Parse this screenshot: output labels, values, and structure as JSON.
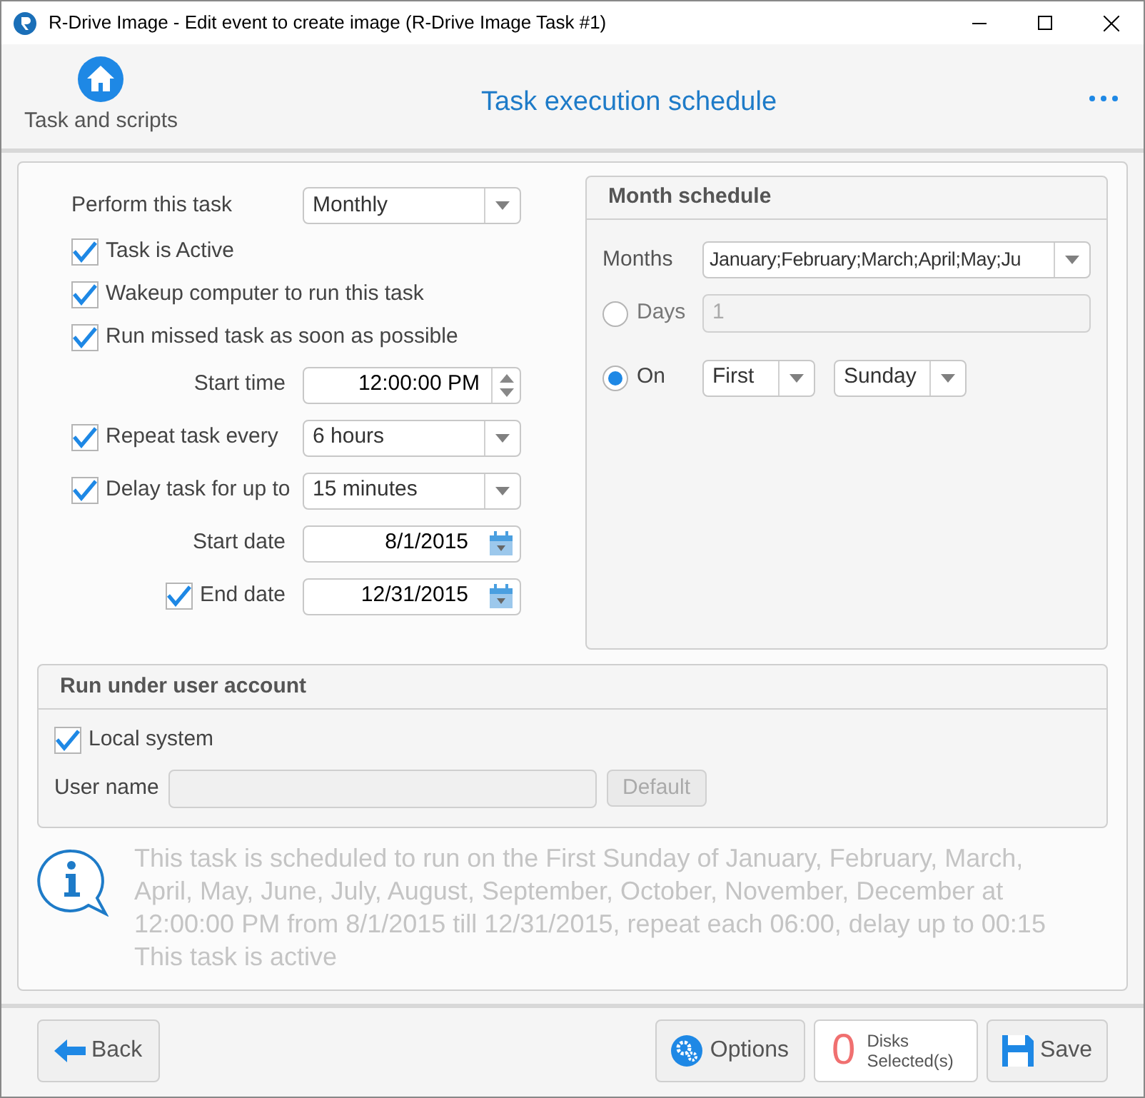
{
  "window": {
    "title": "R-Drive Image - Edit event to create image (R-Drive Image Task #1)"
  },
  "header": {
    "home_label": "Task and scripts",
    "title": "Task execution schedule"
  },
  "left_fields": [
    {
      "kind": "select",
      "label": "Perform this task",
      "value": "Monthly"
    },
    {
      "kind": "checkbox",
      "label": "Task is Active",
      "checked": true
    },
    {
      "kind": "checkbox",
      "label": "Wakeup computer to run this task",
      "checked": true
    },
    {
      "kind": "checkbox",
      "label": "Run missed task as soon as possible",
      "checked": true
    },
    {
      "kind": "spin",
      "label": "Start time",
      "value": "12:00:00 PM"
    },
    {
      "kind": "check_select",
      "label": "Repeat task every",
      "checked": true,
      "value": "6 hours"
    },
    {
      "kind": "check_select",
      "label": "Delay task for up to",
      "checked": true,
      "value": "15 minutes"
    },
    {
      "kind": "date",
      "label": "Start date",
      "value": "8/1/2015"
    },
    {
      "kind": "check_date",
      "label": "End date",
      "checked": true,
      "value": "12/31/2015"
    }
  ],
  "month_schedule": {
    "title": "Month schedule",
    "months_label": "Months",
    "months_value": "January;February;March;April;May;Ju",
    "options": [
      {
        "kind": "days",
        "label": "Days",
        "selected": false,
        "value": "1"
      },
      {
        "kind": "on",
        "label": "On",
        "selected": true,
        "week": "First",
        "day": "Sunday"
      }
    ]
  },
  "user_account": {
    "title": "Run under user account",
    "local_system": {
      "label": "Local system",
      "checked": true
    },
    "user_name_label": "User name",
    "default_button": "Default"
  },
  "summary": [
    "This task is scheduled to run on the First Sunday of January, February, March, April, May, June, July, August, September, October, November, December at 12:00:00 PM from 8/1/2015 till 12/31/2015, repeat each 06:00, delay up to 00:15",
    "This task is active"
  ],
  "footer": {
    "back": "Back",
    "options": "Options",
    "disks_count": "0",
    "disks_label": "Disks Selected(s)",
    "save": "Save"
  }
}
